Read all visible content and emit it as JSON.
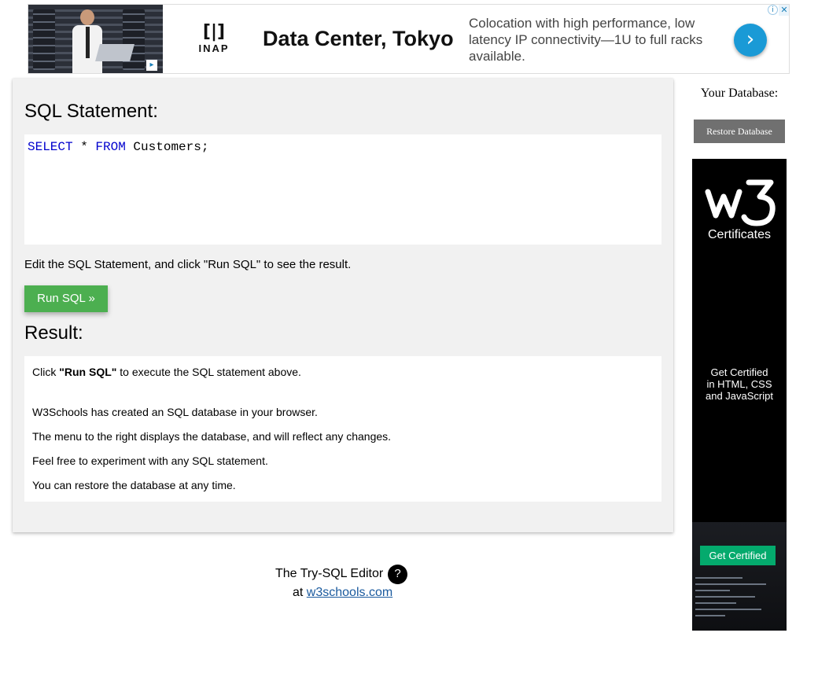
{
  "ad": {
    "logo_word": "INAP",
    "title": "Data Center, Tokyo",
    "copy": "Colocation with high performance, low latency IP connectivity—1U to full racks available.",
    "arrow_icon": "chevron-right-icon"
  },
  "editor": {
    "heading": "SQL Statement:",
    "code_tokens": [
      "SELECT",
      " * ",
      "FROM",
      " Customers;"
    ],
    "hint": "Edit the SQL Statement, and click \"Run SQL\" to see the result.",
    "run_label": "Run SQL »"
  },
  "result": {
    "heading": "Result:",
    "click_prefix": "Click ",
    "click_bold": "\"Run SQL\"",
    "click_suffix": " to execute the SQL statement above.",
    "lines": [
      "W3Schools has created an SQL database in your browser.",
      "The menu to the right displays the database, and will reflect any changes.",
      "Feel free to experiment with any SQL statement.",
      "You can restore the database at any time."
    ]
  },
  "footer": {
    "editor_label": "The Try-SQL Editor",
    "help_symbol": "?",
    "at_label": "at",
    "link_text": "w3schools.com"
  },
  "sidebar": {
    "db_label": "Your Database:",
    "restore_label": "Restore Database"
  },
  "w3ad": {
    "certificates": "Certificates",
    "tagline_lines": [
      "Get Certified",
      "in HTML, CSS",
      "and JavaScript"
    ],
    "button_label": "Get Certified"
  },
  "colors": {
    "run_button": "#4caf50",
    "keyword": "#0000cd",
    "restore_button": "#707070",
    "w3_green": "#04aa6d"
  }
}
